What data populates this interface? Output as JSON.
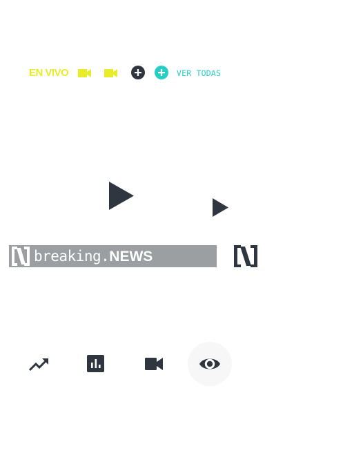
{
  "live": {
    "label": "EN VIVO",
    "color": "#e8ec2a"
  },
  "links": {
    "ver_todas": "VER TODAS",
    "accent": "#25cfc6"
  },
  "breaking": {
    "prefix": "breaking.",
    "suffix": "NEWS",
    "bar_color": "#9b9fa1"
  },
  "icons": {
    "camera_live": "video-camera-icon",
    "camera": "video-camera-icon",
    "plus_dark": "plus-circle-icon",
    "plus_accent": "plus-circle-icon",
    "play_large": "play-icon",
    "play_small": "play-icon",
    "logo_small": "n-logo-icon",
    "logo_large": "n-logo-icon",
    "trending": "trending-up-icon",
    "chart": "bar-chart-icon",
    "video": "video-camera-icon",
    "eye": "eye-icon"
  },
  "colors": {
    "dark": "#2f3640",
    "white": "#ffffff"
  }
}
